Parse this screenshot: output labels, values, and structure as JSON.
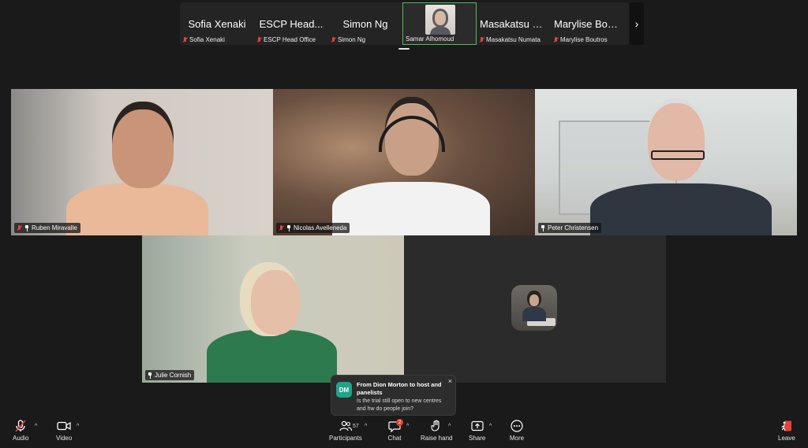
{
  "gallery_strip": {
    "tiles": [
      {
        "display_name": "Sofia Xenaki",
        "label": "Sofia Xenaki",
        "muted": true
      },
      {
        "display_name": "ESCP Head...",
        "label": "ESCP Head Office",
        "muted": true
      },
      {
        "display_name": "Simon Ng",
        "label": "Simon Ng",
        "muted": true
      },
      {
        "display_name": "",
        "label": "Samar Alhomoud",
        "muted": false,
        "active": true
      },
      {
        "display_name": "Masakatsu N...",
        "label": "Masakatsu Numata",
        "muted": true
      },
      {
        "display_name": "Marylise Bout...",
        "label": "Marylise Boutros",
        "muted": true
      }
    ],
    "next_icon": "chevron-right-icon",
    "next_glyph": "›"
  },
  "video_grid": [
    {
      "name": "Ruben Miravalle",
      "muted": true,
      "pinned": true
    },
    {
      "name": "Nicolas Avelleneda",
      "muted": true,
      "pinned": true
    },
    {
      "name": "Peter Christensen",
      "muted": false,
      "pinned": true
    },
    {
      "name": "Julie Cornish",
      "muted": false,
      "pinned": true
    },
    {
      "name": "",
      "muted": false,
      "pinned": false
    }
  ],
  "chat_toast": {
    "avatar_initials": "DM",
    "avatar_color": "#1fa48b",
    "title": "From Dion Morton to host and panelists",
    "message": "Is the trial still open to new centres and hw do people join?",
    "close_glyph": "×"
  },
  "toolbar": {
    "audio_label": "Audio",
    "video_label": "Video",
    "participants_label": "Participants",
    "participants_count": "57",
    "chat_label": "Chat",
    "chat_badge": "2",
    "raise_hand_label": "Raise hand",
    "share_label": "Share",
    "more_label": "More",
    "leave_label": "Leave",
    "caret_glyph": "^"
  },
  "colors": {
    "active_speaker_border": "#4fbf54",
    "muted_red": "#e0443a",
    "background": "#1a1a1a"
  }
}
